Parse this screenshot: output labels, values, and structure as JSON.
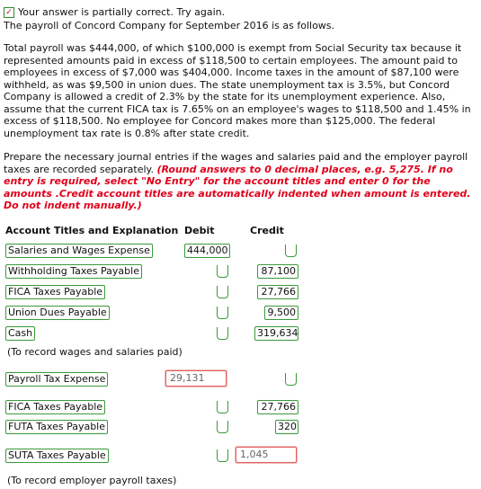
{
  "status": {
    "text": "Your answer is partially correct.  Try again."
  },
  "intro": "The payroll of Concord Company for September 2016 is as follows.",
  "problem_text": "Total payroll was $444,000, of which $100,000 is exempt from Social Security tax because it represented amounts paid in excess of $118,500 to certain employees. The amount paid to employees in excess of $7,000 was $404,000. Income taxes in the amount of $87,100 were withheld, as was $9,500 in union dues. The state unemployment tax is 3.5%, but Concord Company is allowed a credit of 2.3% by the state for its unemployment experience. Also, assume that the current FICA tax is 7.65% on an employee's wages to $118,500 and 1.45% in excess of $118,500. No employee for Concord makes more than $125,000. The federal unemployment tax rate is 0.8% after state credit.",
  "instructions": {
    "normal": "Prepare the necessary journal entries if the wages and salaries paid and the employer payroll taxes are recorded separately. ",
    "red": "(Round answers to 0 decimal places, e.g. 5,275. If no entry is required, select \"No Entry\" for the account titles and enter 0 for the amounts .Credit account titles are automatically indented when amount is entered. Do not indent manually.)"
  },
  "table_headers": {
    "account": "Account Titles and Explanation",
    "debit": "Debit",
    "credit": "Credit"
  },
  "entry1": {
    "rows": [
      {
        "account": "Salaries and Wages Expense",
        "debit": "444,000",
        "credit": ""
      },
      {
        "account": "Withholding Taxes Payable",
        "debit": "",
        "credit": "87,100"
      },
      {
        "account": "FICA Taxes Payable",
        "debit": "",
        "credit": "27,766"
      },
      {
        "account": "Union Dues Payable",
        "debit": "",
        "credit": "9,500"
      },
      {
        "account": "Cash",
        "debit": "",
        "credit": "319,634"
      }
    ],
    "caption": "(To record wages and salaries paid)"
  },
  "entry2": {
    "rows": [
      {
        "account": "Payroll Tax Expense",
        "debit": "29,131",
        "credit": ""
      },
      {
        "account": "FICA Taxes Payable",
        "debit": "",
        "credit": "27,766"
      },
      {
        "account": "FUTA Taxes Payable",
        "debit": "",
        "credit": "320"
      },
      {
        "account": "SUTA Taxes Payable",
        "debit": "",
        "credit": "1,045"
      }
    ],
    "caption": "(To record employer payroll taxes)"
  },
  "colors": {
    "correct": "#3a9a3a",
    "incorrect": "#e06060",
    "instruction_red": "#e0001b"
  },
  "icons": [
    "check-icon",
    "empty-correct-icon"
  ]
}
